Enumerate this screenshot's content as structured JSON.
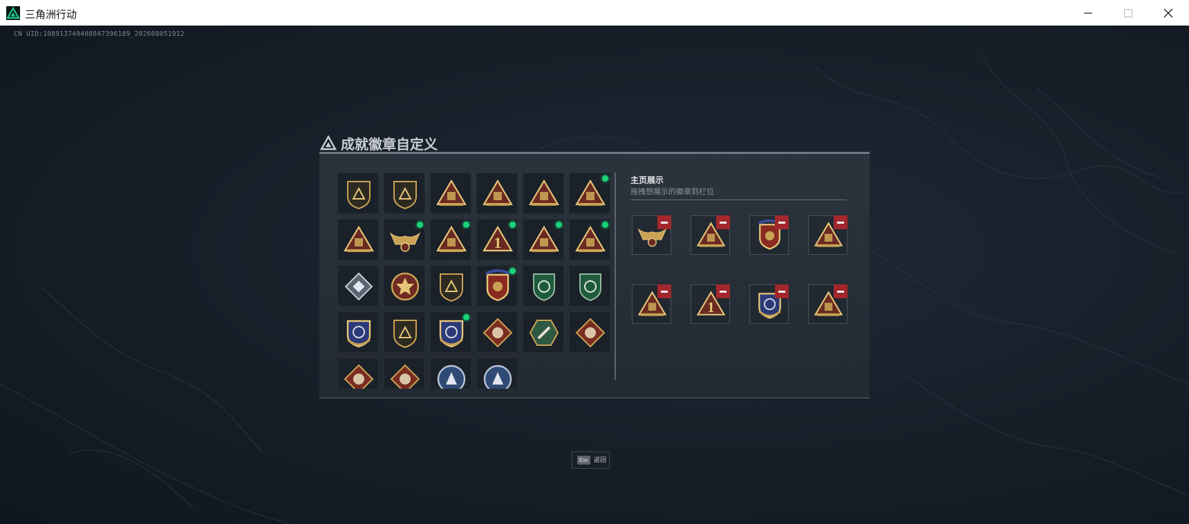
{
  "window": {
    "title": "三角洲行动",
    "minimize_icon": "minimize-icon",
    "maximize_icon": "maximize-icon",
    "close_icon": "close-icon"
  },
  "uid_text": "CN UID:10891374940884739618​9_202608051912",
  "panel": {
    "title": "成就徽章自定义",
    "logo_icon": "delta-logo-icon"
  },
  "badge_grid": [
    {
      "icon": "shield-triangle-badge-icon",
      "style": "shield-dark",
      "new": false
    },
    {
      "icon": "helicopter-badge-icon",
      "style": "shield-dark",
      "new": false
    },
    {
      "icon": "warehouse-triangle-badge-icon",
      "style": "triangle",
      "new": false
    },
    {
      "icon": "lamp-triangle-badge-icon",
      "style": "triangle",
      "new": false
    },
    {
      "icon": "crate-triangle-badge-icon",
      "style": "triangle",
      "new": false
    },
    {
      "icon": "sb-triangle-badge-icon",
      "style": "triangle",
      "new": true
    },
    {
      "icon": "tower-triangle-badge-icon",
      "style": "triangle",
      "new": false
    },
    {
      "icon": "eagle-badge-icon",
      "style": "eagle",
      "new": true
    },
    {
      "icon": "helmet-triangle-badge-icon",
      "style": "triangle",
      "new": true
    },
    {
      "icon": "number-one-triangle-badge-icon",
      "style": "triangle-one",
      "new": true
    },
    {
      "icon": "crate-triangle-badge-icon",
      "style": "triangle",
      "new": true
    },
    {
      "icon": "ruins-triangle-badge-icon",
      "style": "triangle",
      "new": true
    },
    {
      "icon": "cube-diamond-badge-icon",
      "style": "diamond-silver",
      "new": false
    },
    {
      "icon": "star-wreath-badge-icon",
      "style": "star",
      "new": false
    },
    {
      "icon": "chevron-shield-badge-icon",
      "style": "shield-dark",
      "new": false
    },
    {
      "icon": "stars-shield-badge-icon",
      "style": "shield-red",
      "new": true
    },
    {
      "icon": "lion-shield-badge-icon",
      "style": "shield-green",
      "new": false
    },
    {
      "icon": "wings-shield-badge-icon",
      "style": "shield-green",
      "new": false
    },
    {
      "icon": "rifle-blue-shield-badge-icon",
      "style": "shield-blue",
      "new": false
    },
    {
      "icon": "rifle-dark-shield-badge-icon",
      "style": "shield-dark",
      "new": false
    },
    {
      "icon": "crest-shield-badge-icon",
      "style": "shield-blue",
      "new": true
    },
    {
      "icon": "fox-diamond-badge-icon",
      "style": "diamond-red",
      "new": false
    },
    {
      "icon": "wrench-hexagon-badge-icon",
      "style": "hexagon-green",
      "new": false
    },
    {
      "icon": "dragon-diamond-badge-icon",
      "style": "diamond-red",
      "new": false
    },
    {
      "icon": "dragon-diamond-badge-icon",
      "style": "diamond-red",
      "new": false
    },
    {
      "icon": "runner-diamond-badge-icon",
      "style": "diamond-red",
      "new": false
    },
    {
      "icon": "wolf-round-badge-icon",
      "style": "round-blue",
      "new": false
    },
    {
      "icon": "wolf-round-badge-icon",
      "style": "round-blue",
      "new": false
    }
  ],
  "display": {
    "title": "主页展示",
    "subtitle": "拖拽想展示的徽章到栏位",
    "slots": [
      {
        "icon": "eagle-badge-icon",
        "style": "eagle",
        "remove_icon": "remove-icon"
      },
      {
        "icon": "crate-triangle-badge-icon",
        "style": "triangle",
        "remove_icon": "remove-icon"
      },
      {
        "icon": "stars-shield-badge-icon",
        "style": "shield-red",
        "remove_icon": "remove-icon"
      },
      {
        "icon": "sb-triangle-badge-icon",
        "style": "triangle",
        "remove_icon": "remove-icon"
      },
      {
        "icon": "helmet-triangle-badge-icon",
        "style": "triangle",
        "remove_icon": "remove-icon"
      },
      {
        "icon": "number-one-triangle-badge-icon",
        "style": "triangle-one",
        "remove_icon": "remove-icon"
      },
      {
        "icon": "crest-shield-badge-icon",
        "style": "shield-blue",
        "remove_icon": "remove-icon"
      },
      {
        "icon": "ruins-triangle-badge-icon",
        "style": "triangle",
        "remove_icon": "remove-icon"
      }
    ]
  },
  "footer": {
    "esc_key": "Esc",
    "back_label": "返回"
  },
  "colors": {
    "gold": "#c9a254",
    "gold_light": "#e6c77a",
    "dark_red": "#6a2a22",
    "new_dot": "#19d27a",
    "remove_red": "#a3272c",
    "brand_green": "#1ec98a"
  }
}
